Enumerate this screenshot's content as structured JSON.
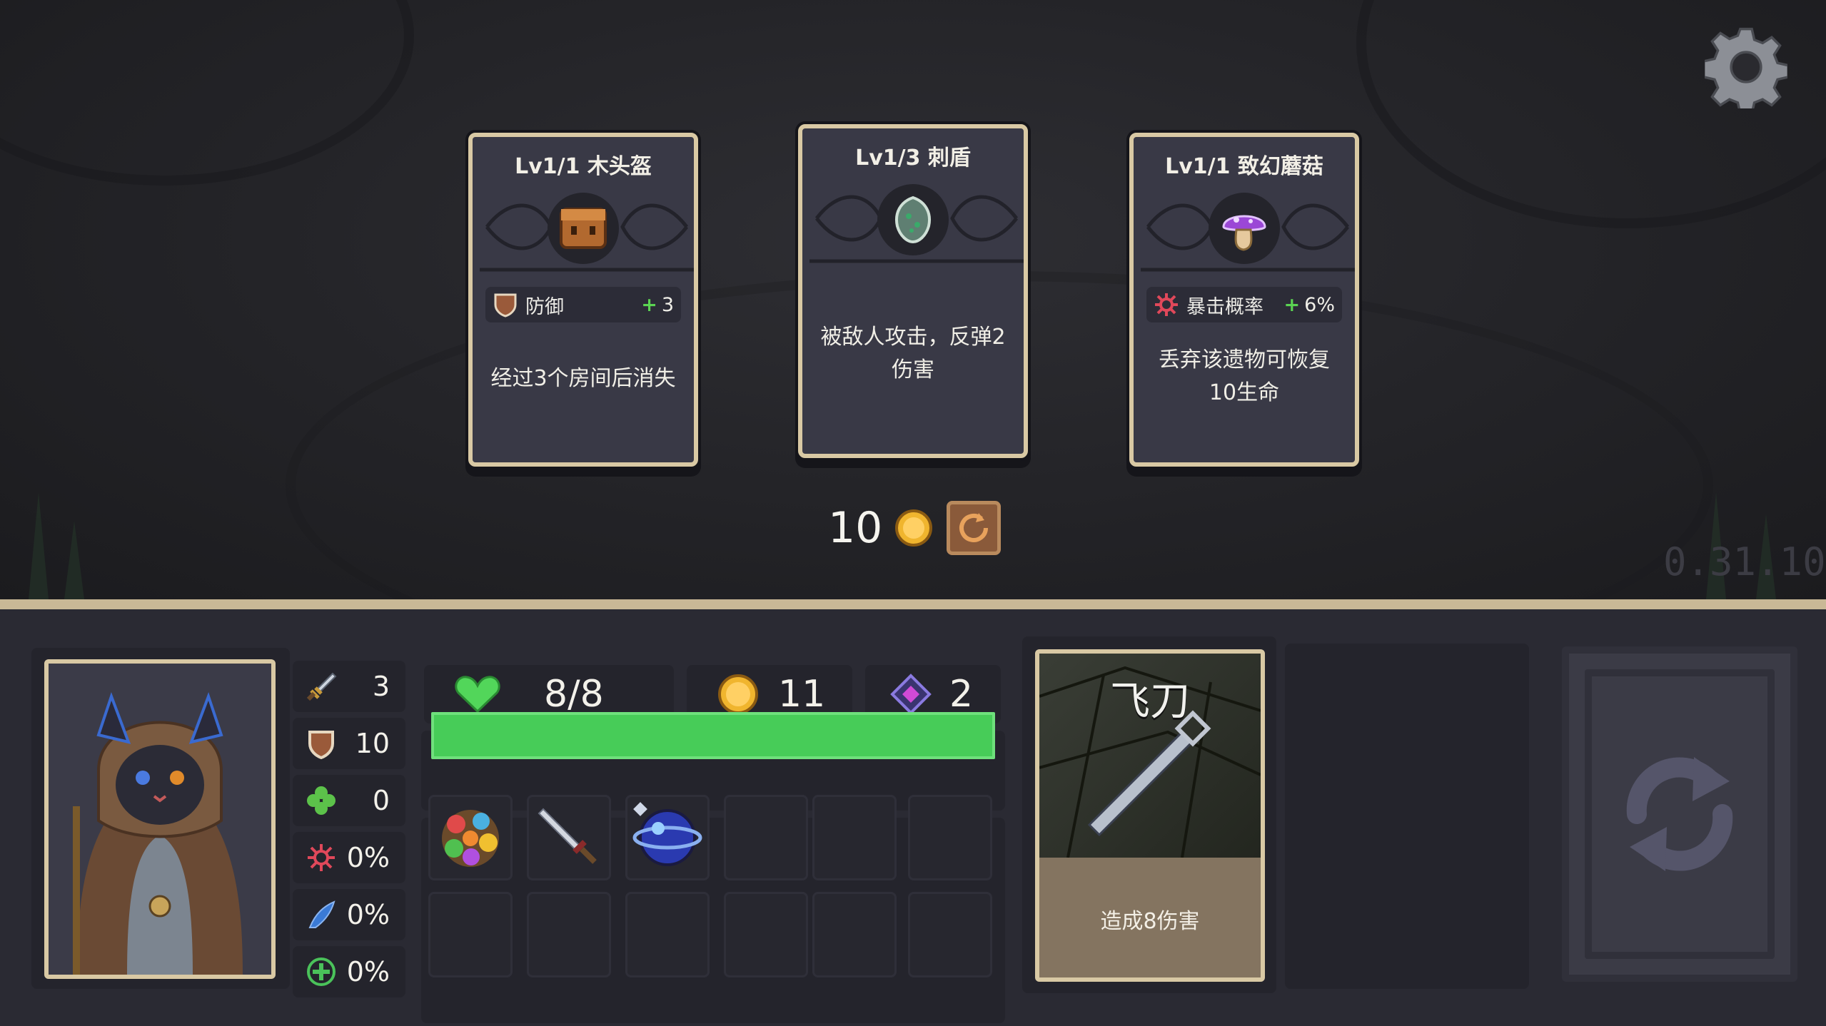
{
  "version": "0.31.10",
  "relic_cards": [
    {
      "title": "Lv1/1 木头盔",
      "icon": "wooden-helmet-icon",
      "stat": {
        "icon": "shield-icon",
        "label": "防御",
        "value": "3"
      },
      "description": "经过3个房间后消失"
    },
    {
      "title": "Lv1/3 刺盾",
      "icon": "spiked-shield-icon",
      "stat": null,
      "description": "被敌人攻击，反弹2 伤害"
    },
    {
      "title": "Lv1/1 致幻蘑菇",
      "icon": "mushroom-icon",
      "stat": {
        "icon": "crit-icon",
        "label": "暴击概率",
        "value": "6%"
      },
      "description": "丢弃该遗物可恢复10生命"
    }
  ],
  "reroll": {
    "cost": "10",
    "coin_icon": "gold-coin-icon",
    "button_icon": "reroll-icon"
  },
  "player": {
    "portrait": "hooded-cat-portrait",
    "stats": [
      {
        "icon": "sword-icon",
        "value": "3"
      },
      {
        "icon": "shield-icon",
        "value": "10"
      },
      {
        "icon": "clover-icon",
        "value": "0"
      },
      {
        "icon": "crit-icon",
        "value": "0%"
      },
      {
        "icon": "dodge-icon",
        "value": "0%"
      },
      {
        "icon": "heal-icon",
        "value": "0%"
      }
    ],
    "hp": "8/8",
    "hp_fraction": 1.0,
    "gold": "11",
    "gems": "2"
  },
  "inventory": [
    "orb-cluster-icon",
    "dagger-icon",
    "blue-orb-icon",
    "",
    "",
    "",
    "",
    "",
    "",
    "",
    "",
    ""
  ],
  "skill_card": {
    "name": "飞刀",
    "description": "造成8伤害"
  },
  "colors": {
    "hp": "#47cc58",
    "card_border": "#d9c9a4",
    "panel": "#24242c",
    "background": "#2a2a33"
  }
}
